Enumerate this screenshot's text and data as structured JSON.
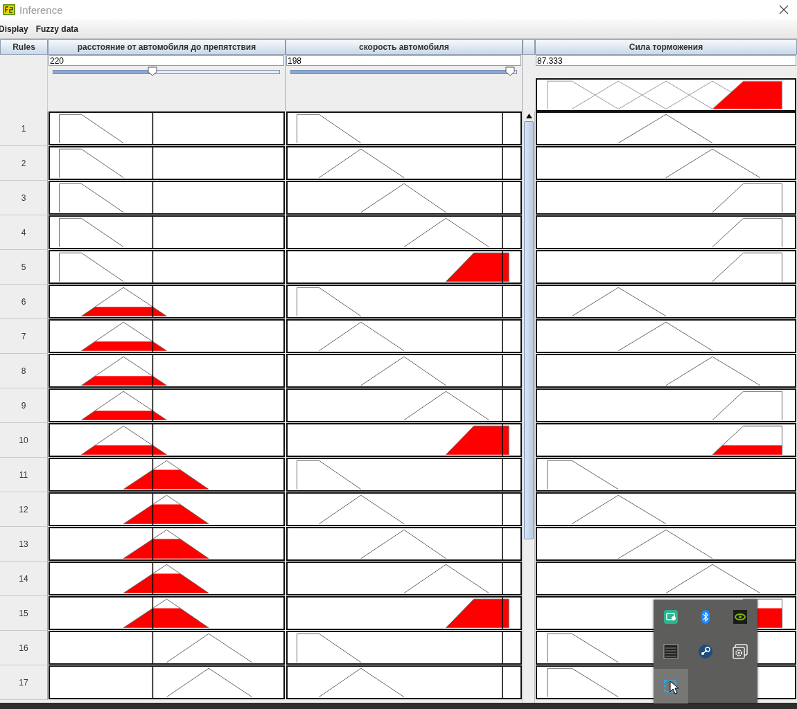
{
  "window": {
    "title": "Inference"
  },
  "menu": [
    "Display",
    "Fuzzy data"
  ],
  "rules_header": "Rules",
  "columns": [
    {
      "title": "расстояние от автомобиля до препятствия",
      "value": "220",
      "slider": {
        "level": 0.44
      }
    },
    {
      "title": "скорость автомобиля",
      "value": "198",
      "slider": {
        "level": 0.97
      }
    },
    {
      "title": "Сила торможения",
      "value": "87.333",
      "aggregate": [
        {
          "kind": "shoulder-left"
        },
        {
          "kind": "peak-1"
        },
        {
          "kind": "peak-2"
        },
        {
          "kind": "peak-3"
        },
        {
          "kind": "shoulder-right"
        }
      ]
    }
  ],
  "rules": [
    {
      "number": "1",
      "cells": [
        {
          "kind": "shoulder-left"
        },
        {
          "kind": "shoulder-left"
        },
        {
          "kind": "peak-2"
        }
      ]
    },
    {
      "number": "2",
      "cells": [
        {
          "kind": "shoulder-left"
        },
        {
          "kind": "peak-1"
        },
        {
          "kind": "peak-3"
        }
      ]
    },
    {
      "number": "3",
      "cells": [
        {
          "kind": "shoulder-left"
        },
        {
          "kind": "peak-2"
        },
        {
          "kind": "shoulder-right"
        }
      ]
    },
    {
      "number": "4",
      "cells": [
        {
          "kind": "shoulder-left"
        },
        {
          "kind": "peak-3"
        },
        {
          "kind": "shoulder-right"
        }
      ]
    },
    {
      "number": "5",
      "cells": [
        {
          "kind": "shoulder-left"
        },
        {
          "kind": "shoulder-right"
        },
        {
          "kind": "shoulder-right"
        }
      ]
    },
    {
      "number": "6",
      "cells": [
        {
          "kind": "peak-1"
        },
        {
          "kind": "shoulder-left"
        },
        {
          "kind": "peak-1"
        }
      ]
    },
    {
      "number": "7",
      "cells": [
        {
          "kind": "peak-1"
        },
        {
          "kind": "peak-1"
        },
        {
          "kind": "peak-2"
        }
      ]
    },
    {
      "number": "8",
      "cells": [
        {
          "kind": "peak-1"
        },
        {
          "kind": "peak-2"
        },
        {
          "kind": "peak-3"
        }
      ]
    },
    {
      "number": "9",
      "cells": [
        {
          "kind": "peak-1"
        },
        {
          "kind": "peak-3"
        },
        {
          "kind": "shoulder-right"
        }
      ]
    },
    {
      "number": "10",
      "cells": [
        {
          "kind": "peak-1"
        },
        {
          "kind": "shoulder-right"
        },
        {
          "kind": "shoulder-right"
        }
      ]
    },
    {
      "number": "11",
      "cells": [
        {
          "kind": "peak-2"
        },
        {
          "kind": "shoulder-left"
        },
        {
          "kind": "shoulder-left"
        }
      ]
    },
    {
      "number": "12",
      "cells": [
        {
          "kind": "peak-2"
        },
        {
          "kind": "peak-1"
        },
        {
          "kind": "peak-1"
        }
      ]
    },
    {
      "number": "13",
      "cells": [
        {
          "kind": "peak-2"
        },
        {
          "kind": "peak-2"
        },
        {
          "kind": "peak-2"
        }
      ]
    },
    {
      "number": "14",
      "cells": [
        {
          "kind": "peak-2"
        },
        {
          "kind": "peak-3"
        },
        {
          "kind": "peak-3"
        }
      ]
    },
    {
      "number": "15",
      "cells": [
        {
          "kind": "peak-2"
        },
        {
          "kind": "shoulder-right"
        },
        {
          "kind": "shoulder-right"
        }
      ]
    },
    {
      "number": "16",
      "cells": [
        {
          "kind": "peak-3"
        },
        {
          "kind": "shoulder-left"
        },
        {
          "kind": "shoulder-left"
        }
      ]
    },
    {
      "number": "17",
      "cells": [
        {
          "kind": "peak-3"
        },
        {
          "kind": "peak-1"
        },
        {
          "kind": "shoulder-left"
        }
      ]
    }
  ],
  "tray_popup": {
    "items": [
      {
        "kind": "card",
        "selected": false
      },
      {
        "kind": "bluetooth",
        "selected": false
      },
      {
        "kind": "chip",
        "selected": false
      },
      {
        "kind": "grid",
        "selected": false
      },
      {
        "kind": "steam",
        "selected": false
      },
      {
        "kind": "gear",
        "selected": false
      },
      {
        "kind": "capture",
        "selected": true
      }
    ]
  }
}
